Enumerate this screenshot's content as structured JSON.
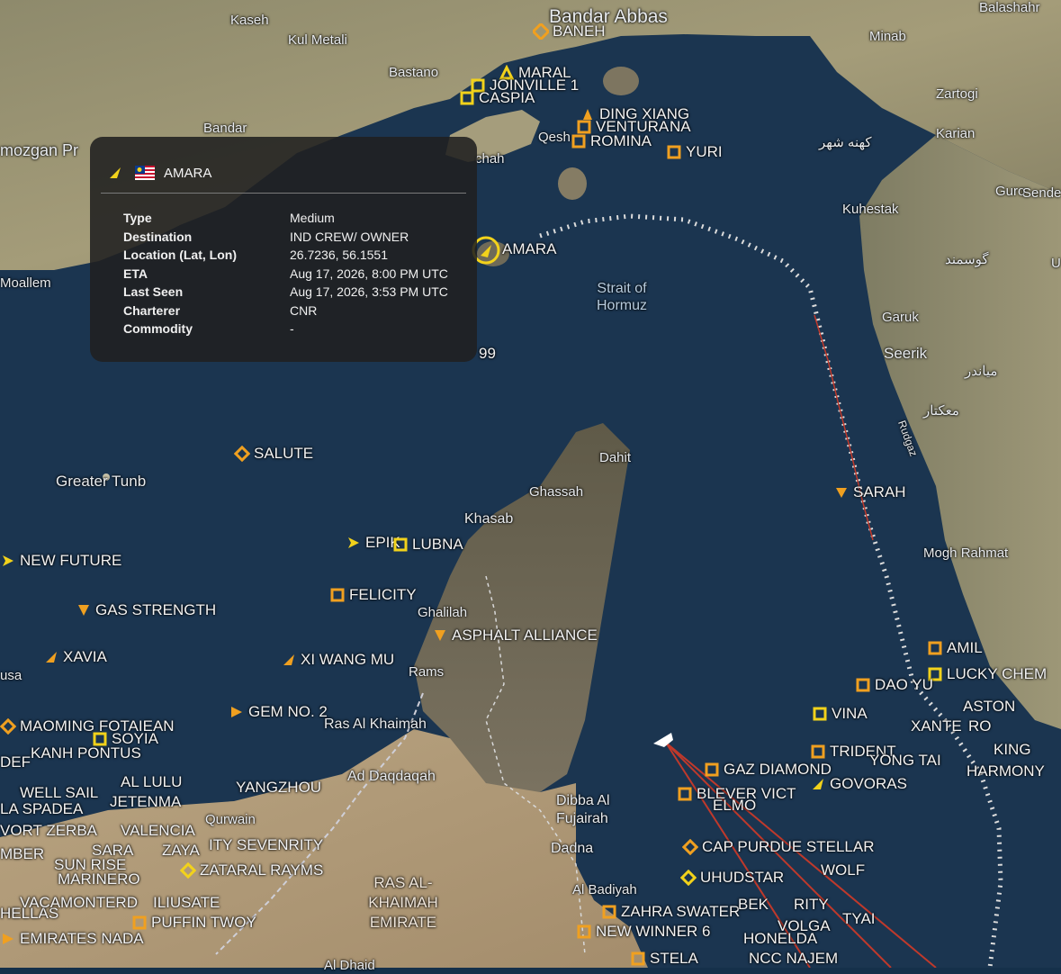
{
  "popup": {
    "ship_name": "AMARA",
    "rows": [
      {
        "key": "Type",
        "value": "Medium"
      },
      {
        "key": "Destination",
        "value": "IND CREW/ OWNER"
      },
      {
        "key": "Location (Lat, Lon)",
        "value": "26.7236, 56.1551"
      },
      {
        "key": "ETA",
        "value": "Aug 17, 2026, 8:00 PM UTC"
      },
      {
        "key": "Last Seen",
        "value": "Aug 17, 2026, 3:53 PM UTC"
      },
      {
        "key": "Charterer",
        "value": "CNR"
      },
      {
        "key": "Commodity",
        "value": "-"
      }
    ]
  },
  "places": [
    "Kaseh",
    "Kul Metali",
    "Bandar Abbas",
    "Balashahr",
    "Minab",
    "Bastano",
    "Zartogi",
    "Bandar",
    "mozgan Pr",
    "Karian",
    "Qesh",
    "chah",
    "کهنه شهر",
    "Guro",
    "Sende",
    "Kuhestak",
    "گوسمند",
    "U",
    "Moallem",
    "Strait of Hormuz",
    "Garuk",
    "Seerik",
    "میاندر",
    "معکتار",
    "Rudgaz",
    "Dahit",
    "Ghassah",
    "Greater Tunb",
    "Khasab",
    "Mogh Rahmat",
    "Ghalilah",
    "usa",
    "Rams",
    "Ras Al Khaimah",
    "Ad Daqdaqah",
    "Dibba Al Fujairah",
    "Qurwain",
    "Dadna",
    "RAS AL-KHAIMAH EMIRATE",
    "Al Badiyah",
    "Al Dhaid"
  ],
  "ships": [
    "BANEH",
    "MARAL",
    "JOINVILLE 1",
    "CASPIA",
    "DING XIANG",
    "VENTURA",
    "NA",
    "ROMINA",
    "YURI",
    "AMARA",
    "99",
    "SALUTE",
    "SARAH",
    "NEW FUTURE",
    "EPIK",
    "LUBNA",
    "FELICITY",
    "GAS STRENGTH",
    "ASPHALT ALLIANCE",
    "XAVIA",
    "XI WANG MU",
    "AMIL",
    "LUCKY CHEM",
    "GEM NO. 2",
    "DAO YU",
    "VINA",
    "ASTON",
    "MAOMING FOTAIEAN",
    "SOYIA",
    "KANH PONTUS",
    "XANTE",
    "RO",
    "DEF",
    "TRIDENT",
    "KING",
    "YONG TAI",
    "HARMONY",
    "AL LULU",
    "YANGZHOU",
    "WELL SAIL",
    "JETENMA",
    "GAZ DIAMOND",
    "GOVORAS",
    "BLEVER VICT",
    "ELMO",
    "LA SPADEA",
    "VORT ZERBA",
    "VALENCIA",
    "ITY SEVENRITY",
    "CAP PURDUE STELLAR",
    "MBER",
    "SARA",
    "ZAYA",
    "SUN RISE",
    "MARINERO",
    "ZATARAL RAYMS",
    "UHUDSTAR",
    "WOLF",
    "HELLAS",
    "VACAMONTERD",
    "ILIUSATE",
    "ZAHRA SWATER",
    "BEK",
    "RITY",
    "PUFFIN TWOY",
    "NEW WINNER 6",
    "VOLGA",
    "TYAI",
    "EMIRATES NADA",
    "HONELDA",
    "STELA",
    "NCC NAJEM"
  ]
}
